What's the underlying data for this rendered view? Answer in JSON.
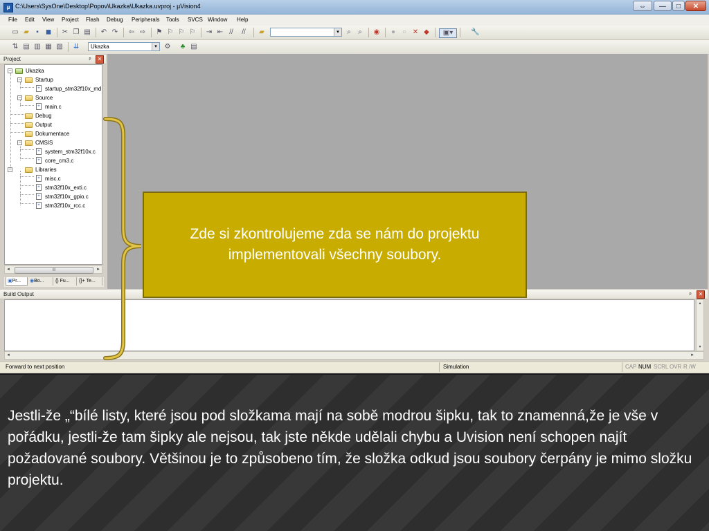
{
  "window": {
    "title": "C:\\Users\\SysOne\\Desktop\\Popov\\Ukazka\\Ukazka.uvproj - µVision4",
    "controls": {
      "restore": "⇔",
      "minimize": "—",
      "maximize": "□",
      "close": "✕"
    }
  },
  "menu": [
    "File",
    "Edit",
    "View",
    "Project",
    "Flash",
    "Debug",
    "Peripherals",
    "Tools",
    "SVCS",
    "Window",
    "Help"
  ],
  "toolbar": {
    "target_select": "Ukazka"
  },
  "project_panel": {
    "title": "Project",
    "tree": [
      {
        "label": "Ukazka",
        "type": "root"
      },
      {
        "label": "Startup",
        "type": "folder"
      },
      {
        "label": "startup_stm32f10x_md.s",
        "type": "file"
      },
      {
        "label": "Source",
        "type": "folder"
      },
      {
        "label": "main.c",
        "type": "file"
      },
      {
        "label": "Debug",
        "type": "folder"
      },
      {
        "label": "Output",
        "type": "folder"
      },
      {
        "label": "Dokumentace",
        "type": "folder"
      },
      {
        "label": "CMSIS",
        "type": "folder"
      },
      {
        "label": "system_stm32f10x.c",
        "type": "file"
      },
      {
        "label": "core_cm3.c",
        "type": "file"
      },
      {
        "label": "Libraries",
        "type": "folder"
      },
      {
        "label": "misc.c",
        "type": "file"
      },
      {
        "label": "stm32f10x_exti.c",
        "type": "file"
      },
      {
        "label": "stm32f10x_gpio.c",
        "type": "file"
      },
      {
        "label": "stm32f10x_rcc.c",
        "type": "file"
      }
    ],
    "tabs": [
      "Pr...",
      "Bo...",
      "{} Fu...",
      "{}+ Te..."
    ],
    "scroll_thumb": "III"
  },
  "build_output": {
    "title": "Build Output"
  },
  "statusbar": {
    "message": "Forward to next position",
    "mode": "Simulation",
    "indicators": [
      {
        "label": "CAP",
        "on": false
      },
      {
        "label": "NUM",
        "on": true
      },
      {
        "label": "SCRL",
        "on": false
      },
      {
        "label": "OVR",
        "on": false
      },
      {
        "label": "R /W",
        "on": false
      }
    ]
  },
  "callout": {
    "text": "Zde si zkontrolujeme zda se nám do projektu implementovali všechny soubory."
  },
  "caption": {
    "text": "Jestli-že „“bílé listy, které jsou pod složkama mají na sobě modrou šipku, tak to znamenná,že je vše v pořádku, jestli-že tam šipky ale nejsou, tak jste někde udělali chybu a Uvision není schopen najít požadované soubory. Většinou je to způsobeno tím, že složka odkud jsou soubory čerpány je mimo složku projektu."
  },
  "colors": {
    "callout_bg": "#c8ad00",
    "brace": "#d8b830",
    "editor_bg": "#a9a9a9"
  }
}
